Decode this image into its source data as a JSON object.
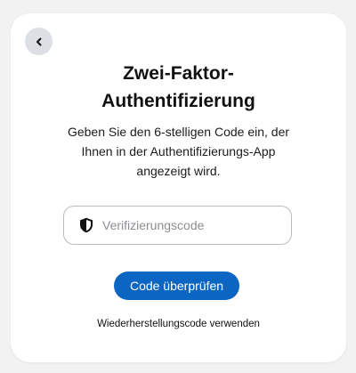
{
  "header": {
    "back_icon": "chevron-left-icon",
    "title": "Zwei-Faktor-Authentifizierung"
  },
  "content": {
    "description": "Geben Sie den 6-stelligen Code ein, der Ihnen in der Authentifizierungs-App angezeigt wird."
  },
  "form": {
    "input_icon": "shield-icon",
    "input_placeholder": "Verifizierungscode",
    "input_value": "",
    "submit_label": "Code überprüfen"
  },
  "footer": {
    "recovery_link": "Wiederherstellungscode verwenden"
  },
  "colors": {
    "accent": "#0a66c2",
    "back_button_bg": "#dcdfe3",
    "page_bg": "#f2f2f2",
    "card_bg": "#ffffff"
  }
}
